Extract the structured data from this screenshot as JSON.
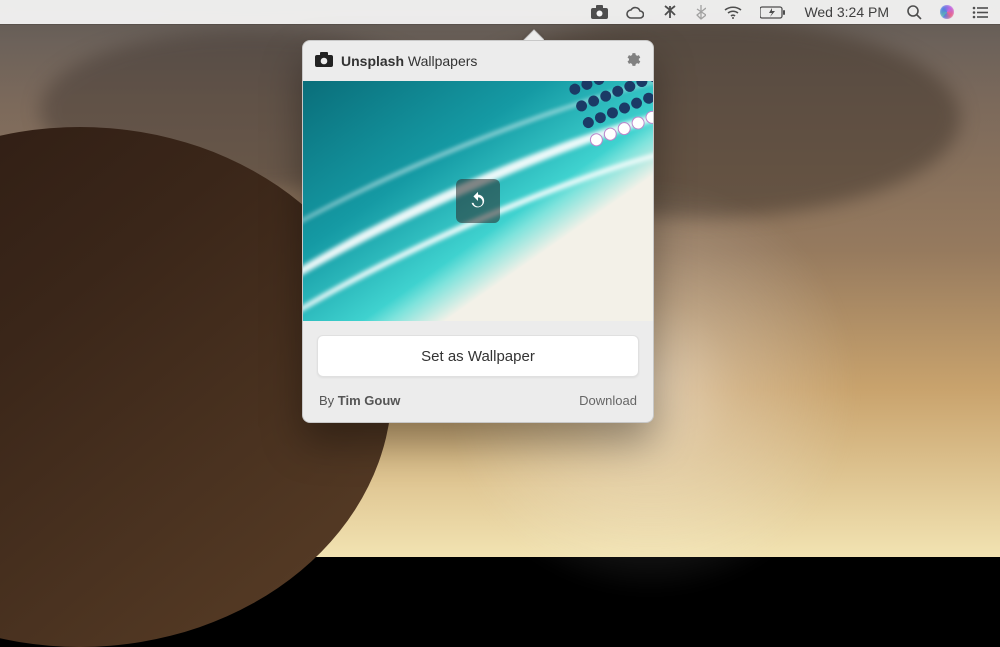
{
  "menubar": {
    "datetime": "Wed 3:24 PM",
    "icons": [
      "camera",
      "cloud",
      "branch",
      "bluetooth",
      "wifi",
      "battery-charging",
      "datetime",
      "search",
      "siri",
      "list"
    ]
  },
  "popover": {
    "brand": "Unsplash",
    "product": "Wallpapers",
    "settings_icon": "gear-icon",
    "refresh_icon": "refresh-icon",
    "set_button_label": "Set as Wallpaper",
    "byline_prefix": "By ",
    "author": "Tim Gouw",
    "download_label": "Download"
  }
}
